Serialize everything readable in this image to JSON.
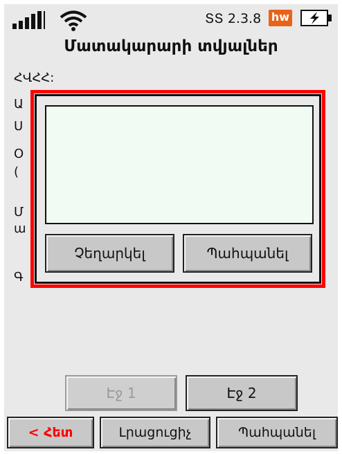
{
  "status_bar": {
    "version": "ՏՏ 2.3.8",
    "brand_badge": "hw",
    "brand_color": "#e8631a"
  },
  "title": "Մատակարարի տվյալներ",
  "form": {
    "tin_label": "ՀՎՀՀ:",
    "hidden_label_initials": [
      "Ա",
      "Ս",
      "Օ",
      "(",
      "Մ",
      "ա",
      "Գ"
    ]
  },
  "dialog": {
    "text_value": "",
    "cancel_label": "Չեղարկել",
    "save_label": "Պահպանել",
    "highlight_color": "#ff0000"
  },
  "pagination": {
    "page1_label": "Էջ 1",
    "page2_label": "Էջ 2"
  },
  "bottom_bar": {
    "back_label": "< Հետ",
    "extra_label": "Լրացուցիչ",
    "save_label": "Պահպանել"
  }
}
